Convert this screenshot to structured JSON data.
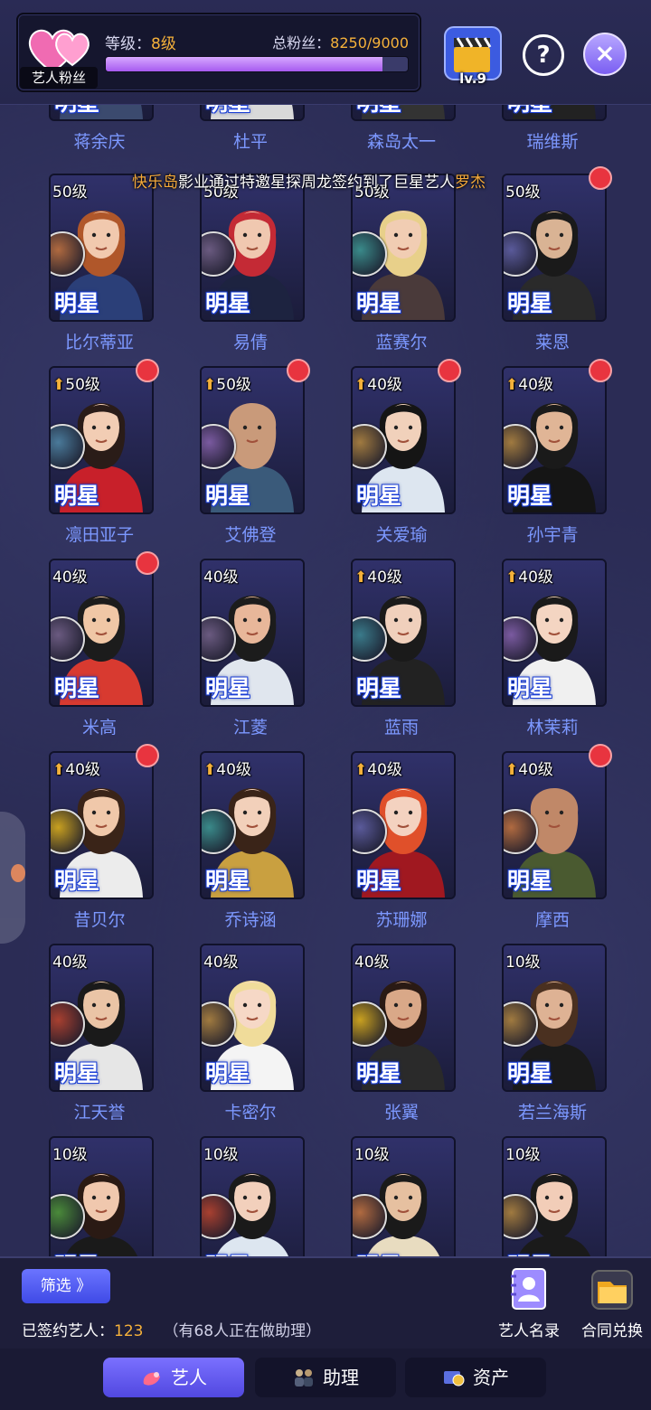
{
  "header": {
    "fan_label": "艺人粉丝",
    "level_label": "等级：",
    "level_value": "8级",
    "fans_label": "总粉丝：",
    "fans_value": "8250/9000",
    "fans_progress": 0.9167,
    "clapper_level": "lv.9",
    "help_label": "?",
    "close_label": "×"
  },
  "marquee": {
    "part1": "快乐岛",
    "part2": "影业通过特邀星探周龙签约到了巨星艺人",
    "part3": "罗杰"
  },
  "star_label": "明星",
  "artists": [
    {
      "name": "蒋余庆",
      "level": "",
      "up": false,
      "dot": false,
      "badge": "#8a6a50",
      "hair": "#3a2a22",
      "skin": "#e9c2a4",
      "cloth": "#3b4a6e"
    },
    {
      "name": "杜平",
      "level": "",
      "up": false,
      "dot": false,
      "badge": "#6a6a80",
      "hair": "#2a2422",
      "skin": "#e0b898",
      "cloth": "#d9d9d9"
    },
    {
      "name": "森岛太一",
      "level": "",
      "up": false,
      "dot": false,
      "badge": "#6a5a70",
      "hair": "#1a1a1a",
      "skin": "#e6c2a2",
      "cloth": "#333"
    },
    {
      "name": "瑞维斯",
      "level": "",
      "up": false,
      "dot": false,
      "badge": "#6a5a70",
      "hair": "#1a1a1a",
      "skin": "#d8b090",
      "cloth": "#222"
    },
    {
      "name": "比尔蒂亚",
      "level": "50级",
      "up": false,
      "dot": false,
      "badge": "#b06a40",
      "hair": "#b0572a",
      "skin": "#f1c9ae",
      "cloth": "#2b3f78"
    },
    {
      "name": "易倩",
      "level": "50级",
      "up": false,
      "dot": false,
      "badge": "#6a5a80",
      "hair": "#c42a35",
      "skin": "#f0c8b0",
      "cloth": "#1d2340"
    },
    {
      "name": "蓝赛尔",
      "level": "50级",
      "up": false,
      "dot": false,
      "badge": "#3a8a8a",
      "hair": "#e8d08a",
      "skin": "#f1cdb3",
      "cloth": "#4a3a3a"
    },
    {
      "name": "莱恩",
      "level": "50级",
      "up": false,
      "dot": true,
      "badge": "#5a5a9a",
      "hair": "#1a1a1a",
      "skin": "#d9b394",
      "cloth": "#2a2a2a"
    },
    {
      "name": "凛田亚子",
      "level": "50级",
      "up": true,
      "dot": true,
      "badge": "#4a7a9a",
      "hair": "#2a1c18",
      "skin": "#f2cdb4",
      "cloth": "#c8202a"
    },
    {
      "name": "艾佛登",
      "level": "50级",
      "up": true,
      "dot": true,
      "badge": "#7a5aa0",
      "hair": "#c99a7a",
      "skin": "#c99a7a",
      "cloth": "#3a5a7a"
    },
    {
      "name": "关爱瑜",
      "level": "40级",
      "up": true,
      "dot": true,
      "badge": "#a07a40",
      "hair": "#151515",
      "skin": "#f1d1bb",
      "cloth": "#dde6f0"
    },
    {
      "name": "孙宇青",
      "level": "40级",
      "up": true,
      "dot": true,
      "badge": "#a07a40",
      "hair": "#1a1a1a",
      "skin": "#e0b596",
      "cloth": "#151515"
    },
    {
      "name": "米高",
      "level": "40级",
      "up": false,
      "dot": true,
      "badge": "#6a5a80",
      "hair": "#1c1c1c",
      "skin": "#f0c7a6",
      "cloth": "#d83a30"
    },
    {
      "name": "江菱",
      "level": "40级",
      "up": false,
      "dot": false,
      "badge": "#6a5a80",
      "hair": "#1c1c1c",
      "skin": "#e8b79a",
      "cloth": "#e0e6ee"
    },
    {
      "name": "蓝雨",
      "level": "40级",
      "up": true,
      "dot": false,
      "badge": "#3a7a8a",
      "hair": "#1a1a1a",
      "skin": "#f0d0bc",
      "cloth": "#222"
    },
    {
      "name": "林茉莉",
      "level": "40级",
      "up": true,
      "dot": false,
      "badge": "#7a5aa0",
      "hair": "#1a1a1a",
      "skin": "#f4d5c2",
      "cloth": "#f0f0f0"
    },
    {
      "name": "昔贝尔",
      "level": "40级",
      "up": true,
      "dot": true,
      "badge": "#c8a020",
      "hair": "#3a2418",
      "skin": "#f0c8aa",
      "cloth": "#ececec"
    },
    {
      "name": "乔诗涵",
      "level": "40级",
      "up": true,
      "dot": false,
      "badge": "#3a8a8a",
      "hair": "#3a2418",
      "skin": "#f2d0ba",
      "cloth": "#c9a040"
    },
    {
      "name": "苏珊娜",
      "level": "40级",
      "up": true,
      "dot": false,
      "badge": "#5a5a9a",
      "hair": "#e0502a",
      "skin": "#f4d2c0",
      "cloth": "#a01820"
    },
    {
      "name": "摩西",
      "level": "40级",
      "up": true,
      "dot": true,
      "badge": "#b06a40",
      "hair": "#c08868",
      "skin": "#c08868",
      "cloth": "#4a5a30"
    },
    {
      "name": "江天誉",
      "level": "40级",
      "up": false,
      "dot": false,
      "badge": "#a84030",
      "hair": "#1a1a1a",
      "skin": "#eac4a6",
      "cloth": "#e6e6e6"
    },
    {
      "name": "卡密尔",
      "level": "40级",
      "up": false,
      "dot": false,
      "badge": "#a07a40",
      "hair": "#f0dc9a",
      "skin": "#f6d8c6",
      "cloth": "#f4f4f4"
    },
    {
      "name": "张翼",
      "level": "40级",
      "up": false,
      "dot": false,
      "badge": "#c8a020",
      "hair": "#2a1a14",
      "skin": "#d9a888",
      "cloth": "#2a2a2a"
    },
    {
      "name": "若兰海斯",
      "level": "10级",
      "up": false,
      "dot": false,
      "badge": "#a07a40",
      "hair": "#4a3020",
      "skin": "#deb294",
      "cloth": "#1a1a1a"
    },
    {
      "name": "",
      "level": "10级",
      "up": false,
      "dot": false,
      "badge": "#4a8a3a",
      "hair": "#2a1a14",
      "skin": "#f0c8ae",
      "cloth": "#1a1a1a"
    },
    {
      "name": "",
      "level": "10级",
      "up": false,
      "dot": false,
      "badge": "#a84030",
      "hair": "#1a1a1a",
      "skin": "#f2d0bc",
      "cloth": "#dde6f0"
    },
    {
      "name": "",
      "level": "10级",
      "up": false,
      "dot": false,
      "badge": "#b06a40",
      "hair": "#1a1a1a",
      "skin": "#e6c0a0",
      "cloth": "#e8dcc0"
    },
    {
      "name": "",
      "level": "10级",
      "up": false,
      "dot": false,
      "badge": "#a07a40",
      "hair": "#1a1a1a",
      "skin": "#f2cdb8",
      "cloth": "#1a1a1a"
    }
  ],
  "bottom": {
    "filter_label": "筛选 》",
    "signed_label": "已签约艺人：",
    "signed_value": "123",
    "signed_hint": "（有68人正在做助理）",
    "directory_label": "艺人名录",
    "exchange_label": "合同兑换"
  },
  "tabs": [
    {
      "label": "艺人",
      "active": true
    },
    {
      "label": "助理",
      "active": false
    },
    {
      "label": "资产",
      "active": false
    }
  ],
  "colors": {
    "accent": "#f5b13a",
    "name_blue": "#7c98ff",
    "tab_active": "#6a62f5",
    "red_dot": "#e8343f"
  }
}
